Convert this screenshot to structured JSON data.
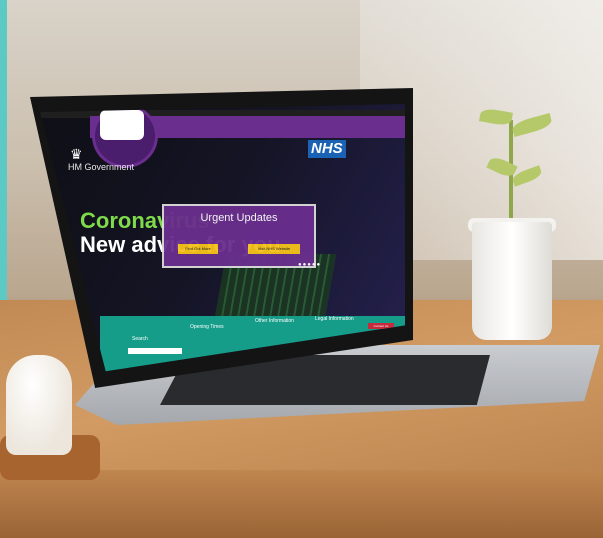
{
  "scene": {
    "colors": {
      "accent_bar": "#5cc9c4",
      "nhs_blue": "#1a63b4",
      "site_purple": "#6a2e8e",
      "footer_teal": "#159d8a",
      "headline_green": "#7fdb4a"
    }
  },
  "website": {
    "brand": "HM Government",
    "nhs_logo": "NHS",
    "headline_green": "Coronavirus",
    "headline_white": "New advice for you",
    "modal": {
      "title": "Urgent Updates",
      "button_left": "Find Out More",
      "button_right": "Visit NHS Website"
    },
    "footer": {
      "search_title": "Search",
      "opening_title": "Opening Times",
      "other_title": "Other Information",
      "legal_title": "Legal Information",
      "contact_button": "Contact Us"
    }
  }
}
